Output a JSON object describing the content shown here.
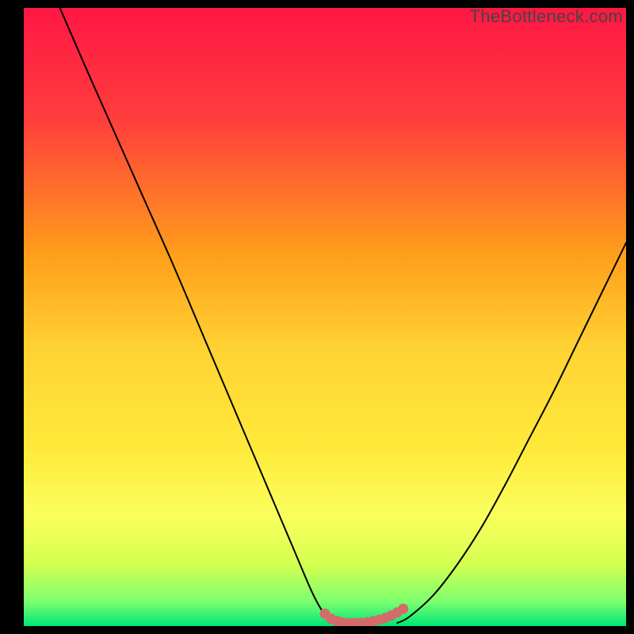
{
  "watermark": "TheBottleneck.com",
  "chart_data": {
    "type": "line",
    "title": "",
    "xlabel": "",
    "ylabel": "",
    "xlim": [
      0,
      100
    ],
    "ylim": [
      0,
      100
    ],
    "gradient_stops": [
      {
        "offset": 0,
        "color": "#ff1744"
      },
      {
        "offset": 18,
        "color": "#ff3d3d"
      },
      {
        "offset": 40,
        "color": "#ff9f1a"
      },
      {
        "offset": 55,
        "color": "#ffd233"
      },
      {
        "offset": 72,
        "color": "#ffeb3b"
      },
      {
        "offset": 82,
        "color": "#faff5e"
      },
      {
        "offset": 90,
        "color": "#d4ff4f"
      },
      {
        "offset": 96,
        "color": "#7dff6e"
      },
      {
        "offset": 100,
        "color": "#00e676"
      }
    ],
    "series": [
      {
        "name": "left-curve",
        "x": [
          6,
          10,
          15,
          20,
          25,
          30,
          35,
          40,
          45,
          48,
          50,
          51.5
        ],
        "y": [
          100,
          91,
          80,
          69,
          58,
          46.5,
          35,
          23.5,
          12,
          5.2,
          1.8,
          0.5
        ]
      },
      {
        "name": "right-curve",
        "x": [
          62,
          64,
          68,
          72,
          76,
          80,
          84,
          88,
          92,
          96,
          100
        ],
        "y": [
          0.5,
          1.5,
          5,
          10,
          16,
          23,
          30.5,
          38,
          46,
          54,
          62
        ]
      },
      {
        "name": "bottom-marker-curve",
        "x": [
          50,
          51,
          52,
          53,
          54,
          55,
          56,
          57,
          58,
          59,
          60,
          61,
          62,
          63
        ],
        "y": [
          2.0,
          1.2,
          0.8,
          0.6,
          0.5,
          0.5,
          0.5,
          0.6,
          0.8,
          1.0,
          1.3,
          1.7,
          2.2,
          2.8
        ]
      }
    ],
    "marker_color": "#d46a6a",
    "curve_color": "#000000"
  }
}
